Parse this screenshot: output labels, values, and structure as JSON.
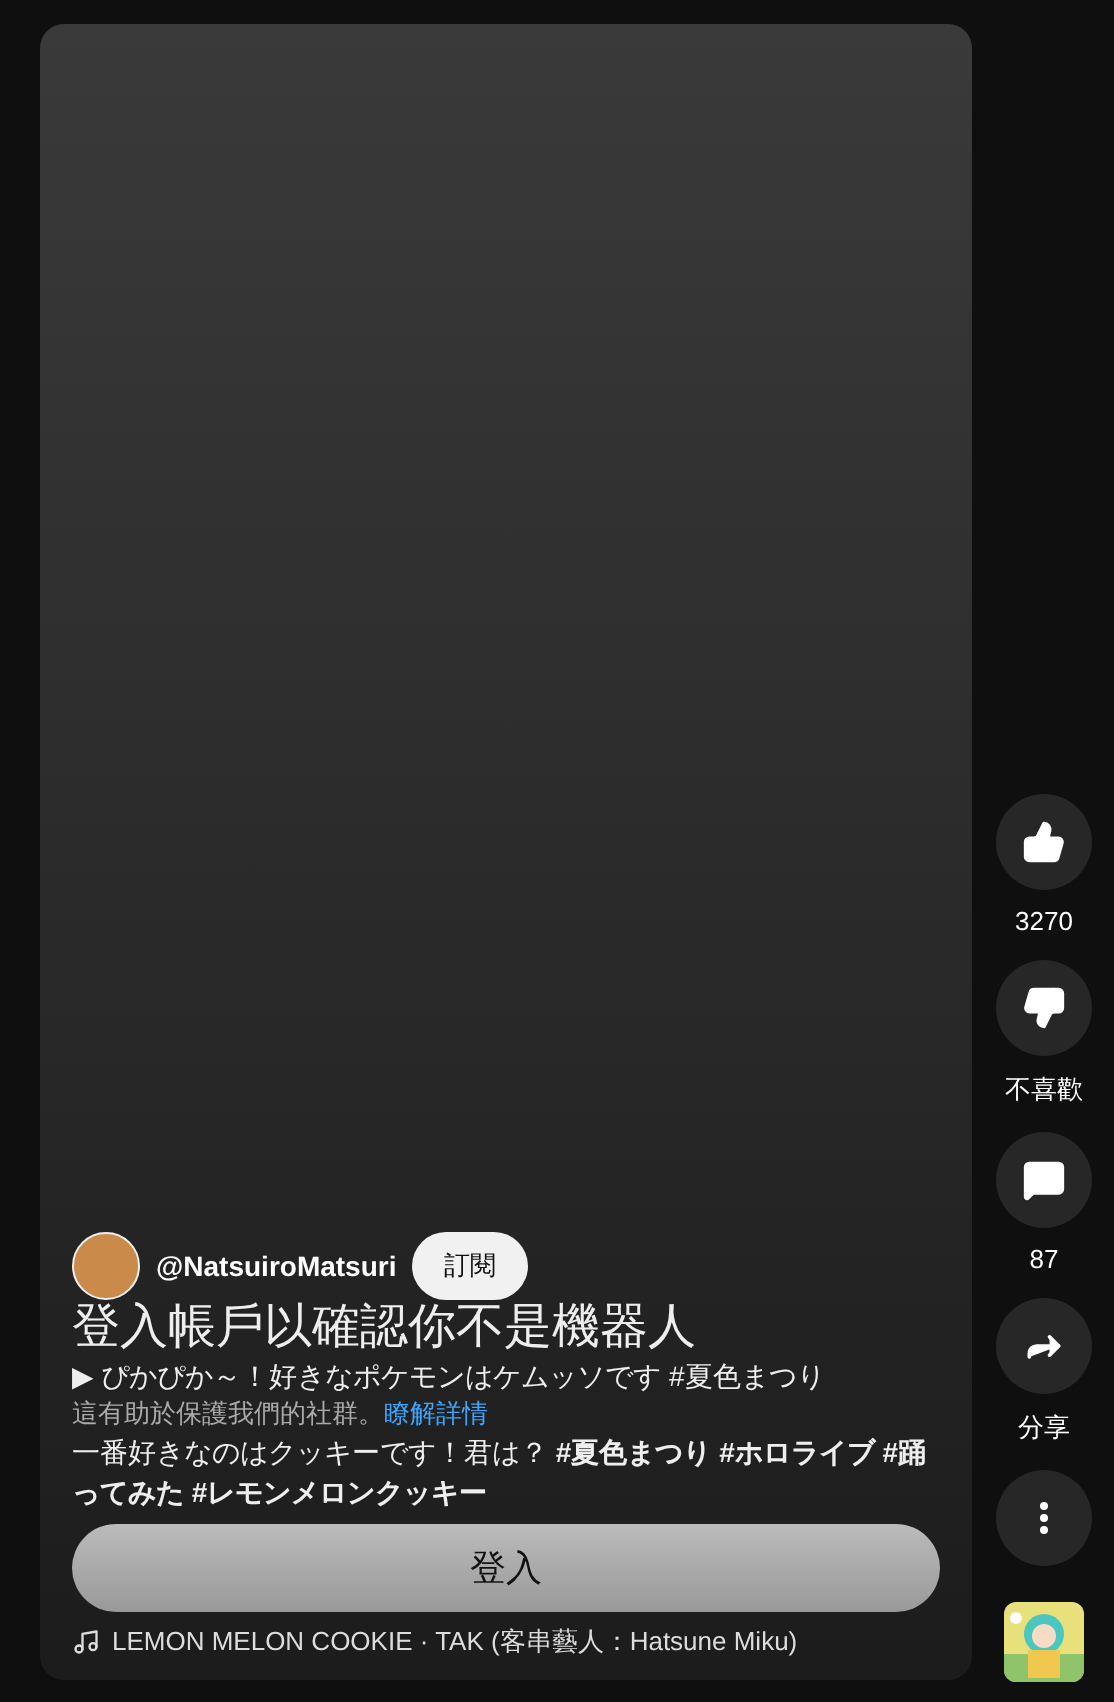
{
  "channel": {
    "handle": "@NatsuiroMatsuri",
    "subscribe_label": "訂閱"
  },
  "overlay": {
    "title": "登入帳戶以確認你不是機器人",
    "note": "這有助於保護我們的社群。",
    "link": "瞭解詳情",
    "button": "登入"
  },
  "video": {
    "title": "▶  ぴかぴか～！好きなポケモンはケムッソです #夏色まつり",
    "description": "一番好きなのはクッキーです！君は？ **#夏色まつり #ホロライブ #踊ってみた #レモンメロンクッキー**",
    "music": "LEMON MELON COOKIE · TAK (客串藝人：Hatsune Miku)"
  },
  "actions": [
    {
      "kind": "like",
      "label": "3270"
    },
    {
      "kind": "dislike",
      "label": "不喜歡"
    },
    {
      "kind": "comment",
      "label": "87"
    },
    {
      "kind": "share",
      "label": "分享"
    },
    {
      "kind": "more"
    }
  ]
}
